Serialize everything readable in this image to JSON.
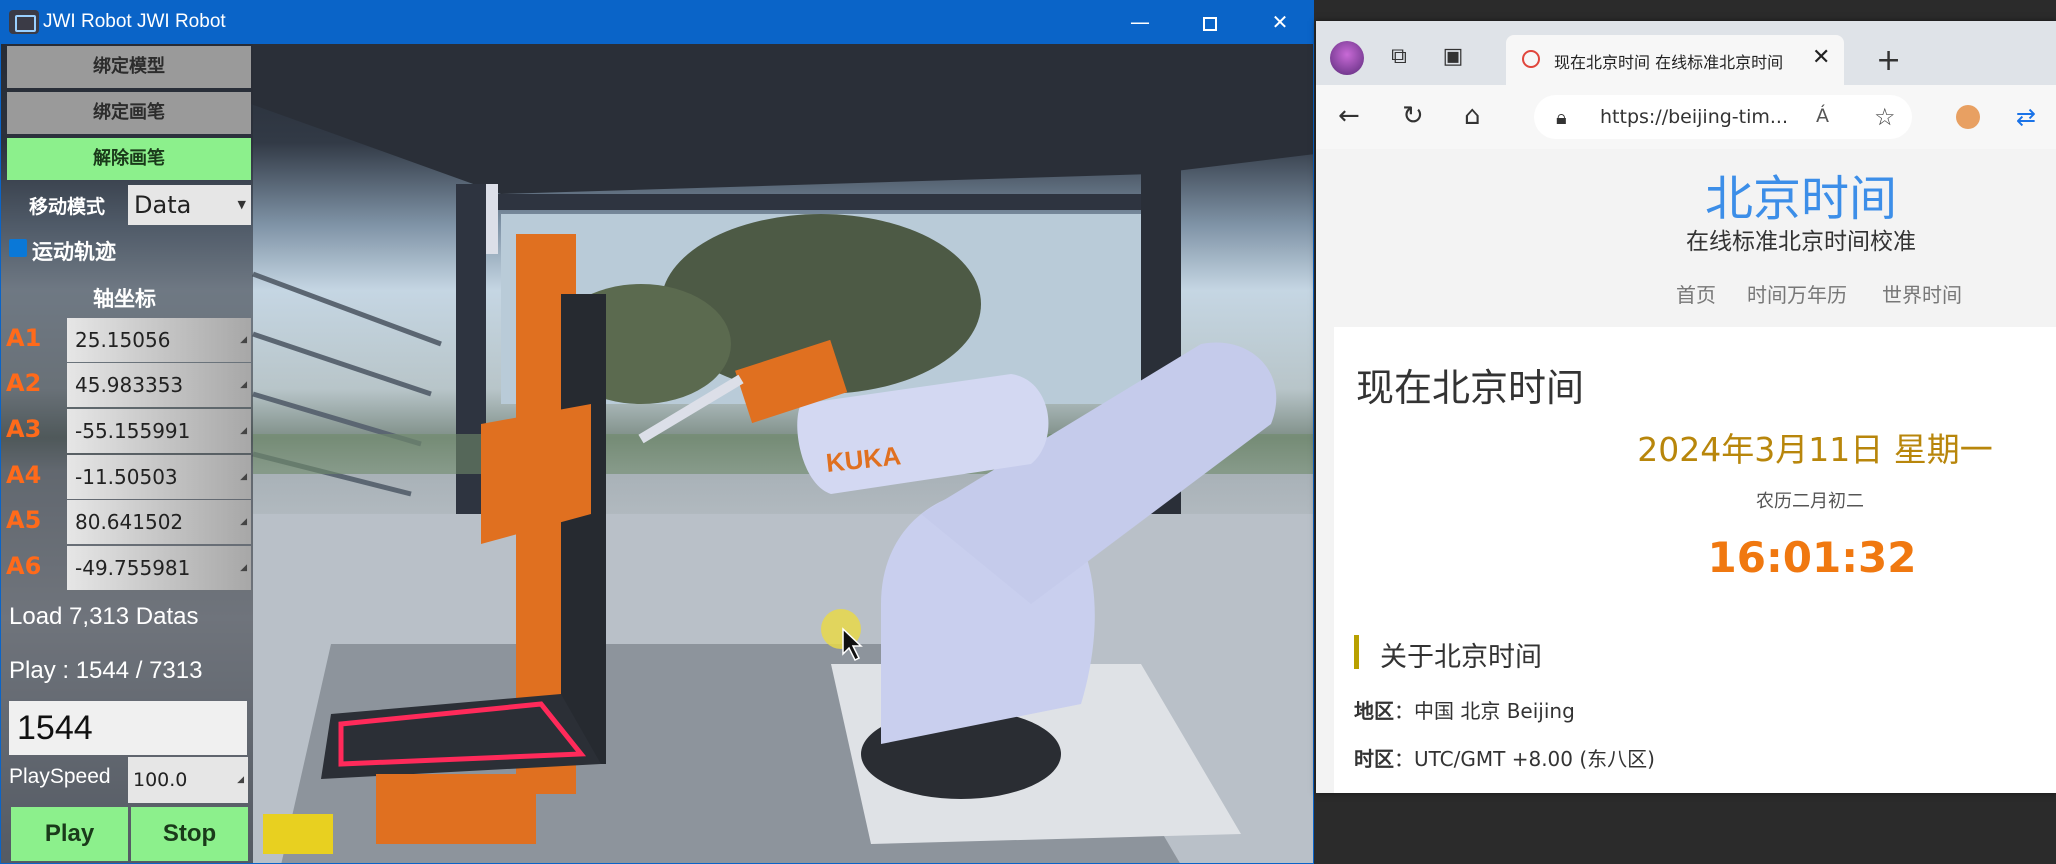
{
  "app": {
    "title": "JWI Robot JWI Robot",
    "window_controls": {
      "minimize": "—",
      "close": "✕"
    },
    "panel": {
      "bind_model": "绑定模型",
      "bind_pen": "绑定画笔",
      "release_pen": "解除画笔",
      "move_mode_label": "移动模式",
      "move_mode_value": "Data",
      "trajectory_label": "运动轨迹",
      "axis_coords_label": "轴坐标",
      "axes": [
        {
          "name": "A1",
          "value": "25.15056"
        },
        {
          "name": "A2",
          "value": "45.983353"
        },
        {
          "name": "A3",
          "value": "-55.155991"
        },
        {
          "name": "A4",
          "value": "-11.50503"
        },
        {
          "name": "A5",
          "value": "80.641502"
        },
        {
          "name": "A6",
          "value": "-49.755981"
        }
      ],
      "load_status": "Load 7,313 Datas",
      "play_status": "Play : 1544 / 7313",
      "frame_value": "1544",
      "speed_label": "PlaySpeed",
      "speed_value": "100.0",
      "play_button": "Play",
      "stop_button": "Stop"
    },
    "scene": {
      "robot_brand": "KUKA"
    }
  },
  "browser": {
    "tab_title": "现在北京时间 在线标准北京时间",
    "url": "https://beijing-tim...",
    "read_aloud": "Á",
    "page": {
      "site_title": "北京时间",
      "site_subtitle": "在线标准北京时间校准",
      "nav": [
        "首页",
        "时间万年历",
        "世界时间"
      ],
      "heading": "现在北京时间",
      "date": "2024年3月11日 星期一",
      "lunar": "农历二月初二",
      "time": "16:01:32",
      "about_heading": "关于北京时间",
      "region_label": "地区",
      "region_value": "中国 北京 Beijing",
      "timezone_label": "时区",
      "timezone_value": "UTC/GMT +8.00 (东八区)"
    }
  },
  "colors": {
    "titlebar": "#0a64c8",
    "green_button": "#8cf08c",
    "axis_label": "#ff6a1a",
    "site_title": "#3c8ee8",
    "date_gold": "#b8860b",
    "clock_orange": "#f07810"
  }
}
